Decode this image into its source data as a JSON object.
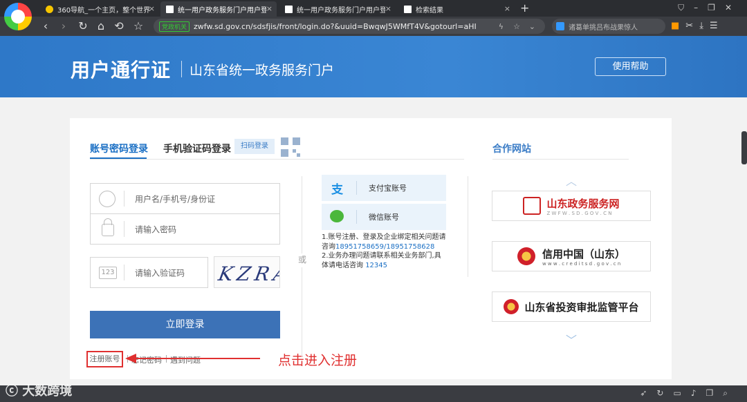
{
  "browser": {
    "tabs": [
      {
        "title": "360导航_一个主页，整个世界",
        "active": false
      },
      {
        "title": "统一用户政务服务门户用户登",
        "active": true
      },
      {
        "title": "统一用户政务服务门户用户登",
        "active": false
      },
      {
        "title": "检索结果",
        "active": false
      }
    ],
    "new_tab": "+",
    "gov_badge": "党政机关",
    "url": "zwfw.sd.gov.cn/sdsfjis/front/login.do?&uuid=BwqwJ5WMfT4V&gotourl=aHI",
    "search_placeholder": "诸葛单挑吕布战果惊人"
  },
  "header": {
    "title": "用户通行证",
    "subtitle": "山东省统一政务服务门户",
    "help_button": "使用帮助"
  },
  "login": {
    "tabs": [
      "账号密码登录",
      "手机验证码登录"
    ],
    "scan_label": "扫码登录",
    "username_placeholder": "用户名/手机号/身份证",
    "password_placeholder": "请输入密码",
    "captcha_placeholder": "请输入验证码",
    "captcha_badge": "123",
    "captcha_text": "KZRA",
    "submit": "立即登录",
    "links": [
      "注册账号",
      "忘记密码",
      "遇到问题"
    ],
    "or": "或"
  },
  "social": {
    "alipay": "支付宝账号",
    "wechat": "微信账号",
    "note1": "1.账号注册、登录及企业绑定相关问题请咨询",
    "note1_phone": "18951758659/18951758628",
    "note2": "2.业务办理问题请联系相关业务部门,具体请电话咨询",
    "note2_phone": "12345"
  },
  "partners": {
    "title": "合作网站",
    "items": [
      {
        "name": "山东政务服务网",
        "sub": "Z W F W . S D . G O V . C N"
      },
      {
        "name": "信用中国（山东）",
        "sub": "w w w . c r e d i t s d . g o v . c n"
      },
      {
        "name": "山东省投资审批监管平台",
        "sub": ""
      }
    ]
  },
  "annotation": {
    "text": "点击进入注册"
  },
  "watermark": "大数跨境",
  "colors": {
    "brand_blue": "#3a7cc6",
    "link_blue": "#1a6fc4",
    "annotation_red": "#e03030"
  }
}
